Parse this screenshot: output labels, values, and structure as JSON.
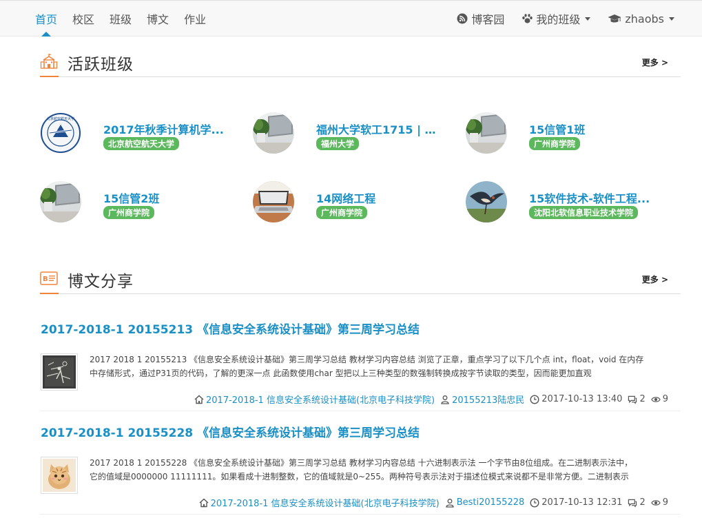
{
  "nav": {
    "items": [
      {
        "label": "首页",
        "active": true
      },
      {
        "label": "校区",
        "active": false
      },
      {
        "label": "班级",
        "active": false
      },
      {
        "label": "博文",
        "active": false
      },
      {
        "label": "作业",
        "active": false
      }
    ],
    "right": {
      "blog": "博客园",
      "my_class": "我的班级",
      "user": "zhaobs"
    }
  },
  "active_classes": {
    "title": "活跃班级",
    "more": "更多 >",
    "items": [
      {
        "name": "2017年秋季计算机学...",
        "school": "北京航空航天大学",
        "avatar": "seal"
      },
      {
        "name": "福州大学软工1715 | Z...",
        "school": "福州大学",
        "avatar": "laptop-plant"
      },
      {
        "name": "15信管1班",
        "school": "广州商学院",
        "avatar": "laptop-plant"
      },
      {
        "name": "15信管2班",
        "school": "广州商学院",
        "avatar": "laptop-plant"
      },
      {
        "name": "14网络工程",
        "school": "广州商学院",
        "avatar": "laptop-open"
      },
      {
        "name": "15软件技术-软件工程...",
        "school": "沈阳北软信息职业技术学院",
        "avatar": "bird"
      }
    ]
  },
  "blog_share": {
    "title": "博文分享",
    "more": "更多 >",
    "posts": [
      {
        "title": "2017-2018-1 20155213 《信息安全系统设计基础》第三周学习总结",
        "desc_line1": "2017 2018 1 20155213 《信息安全系统设计基础》第三周学习总结 教材学习内容总结 浏览了正章，重点学习了以下几个点 int，float，void 在内存",
        "desc_line2": "中存储形式，通过P31页的代码，了解的更深一点 此函数使用char 型把以上三种类型的数强制转换成按字节读取的类型，因而能更加直观",
        "course": "2017-2018-1 信息安全系统设计基础(北京电子科技学院)",
        "author": "20155213陆忠民",
        "time": "2017-10-13 13:40",
        "comments": "2",
        "views": "9",
        "thumb": "chalkboard"
      },
      {
        "title": "2017-2018-1 20155228 《信息安全系统设计基础》第三周学习总结",
        "desc_line1": "2017 2018 1 20155228 《信息安全系统设计基础》第三周学习总结 教材学习内容总结 十六进制表示法 一个字节由8位组成。在二进制表示法中，",
        "desc_line2": "它的值域是0000000 11111111。如果看成十进制整数，它的值域就是0~255。两种符号表示法对于描述位模式来说都不是非常方便。二进制表示",
        "course": "2017-2018-1 信息安全系统设计基础(北京电子科技学院)",
        "author": "Besti20155228",
        "time": "2017-10-13 12:31",
        "comments": "2",
        "views": "9",
        "thumb": "cat"
      }
    ]
  },
  "colors": {
    "link": "#1a8fc5",
    "badge": "#5cb85c",
    "accent": "#f0833a"
  }
}
